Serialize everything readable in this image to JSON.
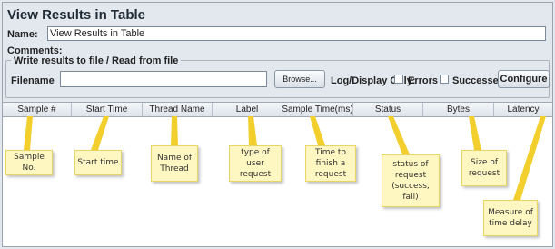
{
  "panel": {
    "title": "View Results in Table",
    "name_label": "Name:",
    "name_value": "View Results in Table",
    "comments_label": "Comments:"
  },
  "file_section": {
    "legend": "Write results to file / Read from file",
    "filename_label": "Filename",
    "filename_value": "",
    "browse_label": "Browse...",
    "log_display_label": "Log/Display Only:",
    "errors_label": "Errors",
    "successes_label": "Successes",
    "errors_checked": false,
    "successes_checked": false,
    "configure_label": "Configure"
  },
  "table": {
    "columns": [
      "Sample #",
      "Start Time",
      "Thread Name",
      "Label",
      "Sample Time(ms)",
      "Status",
      "Bytes",
      "Latency"
    ]
  },
  "annotations": [
    {
      "text": "Sample No."
    },
    {
      "text": "Start time"
    },
    {
      "text": "Name of Thread"
    },
    {
      "text": "type of user request"
    },
    {
      "text": "Time to finish a request"
    },
    {
      "text": "status of request (success, fail)"
    },
    {
      "text": "Size of request"
    },
    {
      "text": "Measure of time delay"
    }
  ],
  "colors": {
    "background": "#e3e8ee",
    "note_fill": "#fff7c2",
    "note_border": "#e7d566",
    "tail_color": "#f2cf2d"
  }
}
